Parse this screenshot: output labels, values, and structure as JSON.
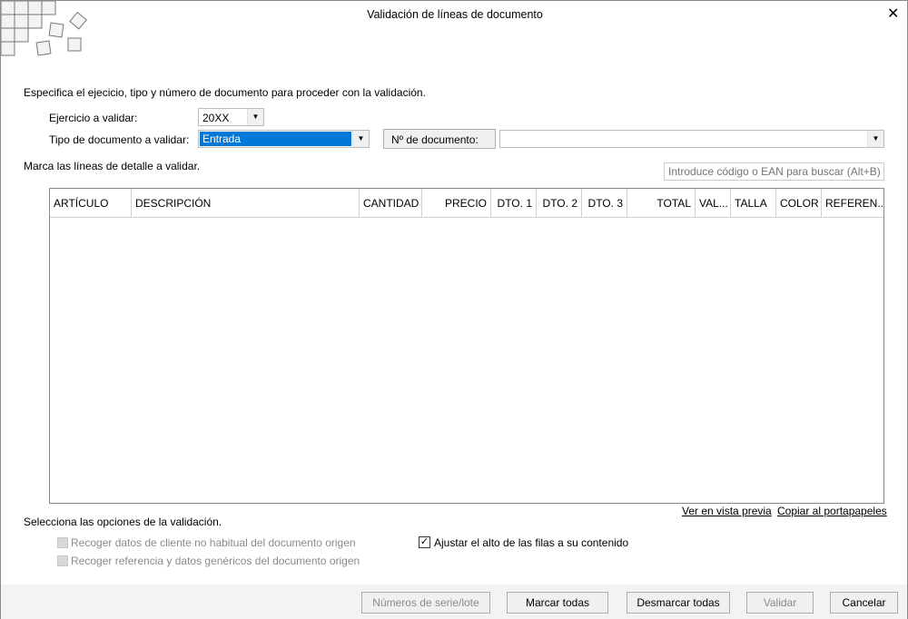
{
  "window": {
    "title": "Validación de líneas de documento",
    "close": "✕"
  },
  "intro": "Especifica el ejecicio, tipo y número de documento para proceder con la validación.",
  "ejercicio": {
    "label": "Ejercicio a validar:",
    "value": "20XX"
  },
  "tipo": {
    "label": "Tipo de documento a validar:",
    "value": "Entrada"
  },
  "numero": {
    "label": "Nº de documento:",
    "value": ""
  },
  "marca": "Marca las líneas de detalle a validar.",
  "search": {
    "placeholder": "Introduce código o EAN para buscar (Alt+B)"
  },
  "columns": [
    "ARTÍCULO",
    "DESCRIPCIÓN",
    "CANTIDAD",
    "PRECIO",
    "DTO. 1",
    "DTO. 2",
    "DTO. 3",
    "TOTAL",
    "VAL...",
    "TALLA",
    "COLOR",
    "REFEREN..."
  ],
  "links": {
    "preview": "Ver en vista previa",
    "copy": "Copiar al portapapeles"
  },
  "options": {
    "title": "Selecciona las opciones de la validación.",
    "opt1": {
      "label": "Recoger datos de cliente no habitual del documento origen",
      "checked": false,
      "enabled": false
    },
    "opt2": {
      "label": "Recoger referencia y datos genéricos del documento origen",
      "checked": false,
      "enabled": false
    },
    "opt3": {
      "label": "Ajustar el alto de las filas a su contenido",
      "checked": true,
      "enabled": true
    }
  },
  "buttons": {
    "serie": "Números de serie/lote",
    "marcar": "Marcar todas",
    "desmarcar": "Desmarcar todas",
    "validar": "Validar",
    "cancelar": "Cancelar"
  },
  "colors": {
    "selection": "#0078d7"
  }
}
